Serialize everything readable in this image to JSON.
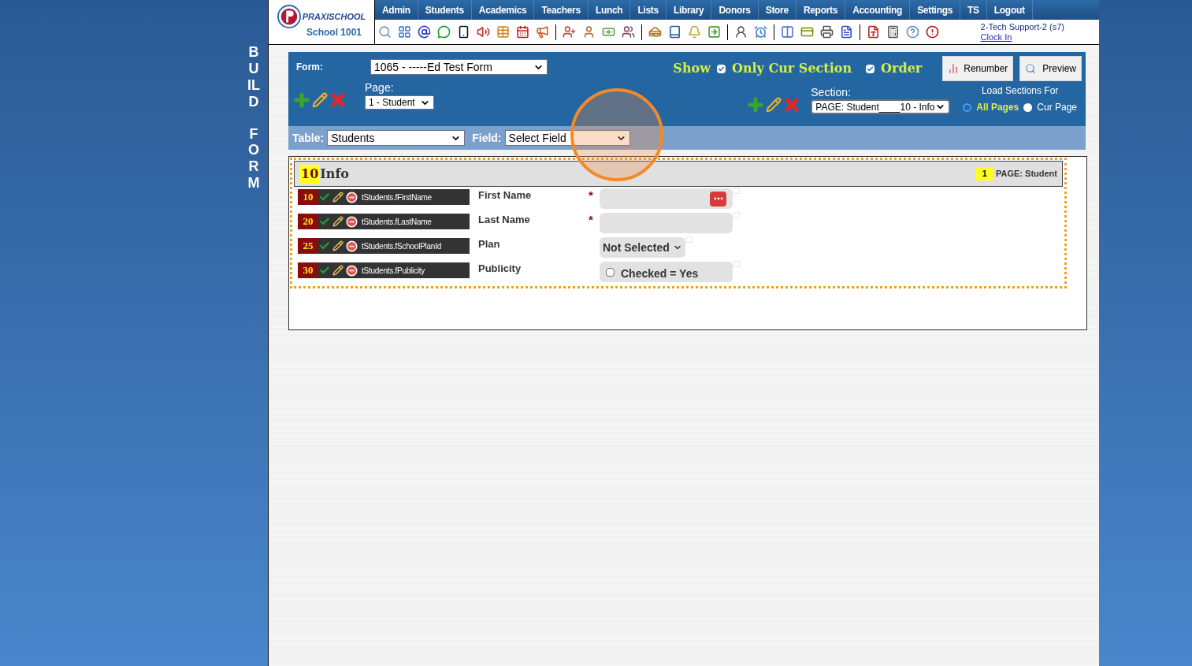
{
  "side_title": [
    "BUILD",
    "FORM"
  ],
  "logo": {
    "brand": "PRAXISCHOOL",
    "school": "School 1001"
  },
  "nav": [
    "Admin",
    "Students",
    "Academics",
    "Teachers",
    "Lunch",
    "Lists",
    "Library",
    "Donors",
    "Store",
    "Reports",
    "Accounting",
    "Settings",
    "TS",
    "Logout"
  ],
  "user": {
    "name": "2-Tech Support-2 (s7)",
    "link": "Clock In"
  },
  "form_panel": {
    "form_label": "Form:",
    "form_value": "1065 - -----Ed Test Form",
    "page_label": "Page:",
    "page_value": "1 - Student",
    "show_label": "Show",
    "only_cur_section": {
      "label": "Only Cur Section",
      "checked": true
    },
    "order": {
      "label": "Order",
      "checked": true
    },
    "renumber": "Renumber",
    "preview": "Preview",
    "section_label": "Section:",
    "section_value": "PAGE: Student____10 - Info",
    "load_label": "Load Sections For",
    "load_options": [
      {
        "label": "All Pages",
        "selected": true
      },
      {
        "label": "Cur Page",
        "selected": false
      }
    ]
  },
  "table_bar": {
    "table_label": "Table:",
    "table_value": "Students",
    "field_label": "Field:",
    "field_value": "Select Field"
  },
  "section": {
    "number": "10",
    "title": "Info",
    "page_number": "1",
    "page_label": "PAGE: Student",
    "fields": [
      {
        "order": "10",
        "column": "tStudents.fFirstName",
        "label": "First Name",
        "marker": "*",
        "kind": "text",
        "menu_button": true
      },
      {
        "order": "20",
        "column": "tStudents.fLastName",
        "label": "Last Name",
        "marker": "*",
        "kind": "text",
        "menu_button": false
      },
      {
        "order": "25",
        "column": "tStudents.fSchoolPlanId",
        "label": "Plan",
        "kind": "select",
        "value": "Not Selected"
      },
      {
        "order": "30",
        "column": "tStudents.fPublicity",
        "label": "Publicity",
        "kind": "checkbox",
        "value": "Checked = Yes",
        "checked": false
      }
    ]
  }
}
